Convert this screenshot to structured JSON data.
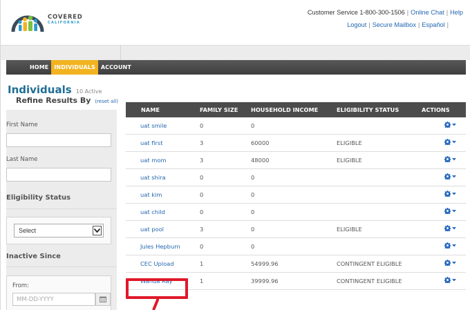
{
  "header": {
    "logo_line1": "COVERED",
    "logo_line2": "CALIFORNIA",
    "customer_service": "Customer Service 1-800-300-1506",
    "online_chat": "Online Chat",
    "help": "Help",
    "logout": "Logout",
    "secure_mailbox": "Secure Mailbox",
    "espanol": "Español"
  },
  "nav": {
    "items": [
      {
        "label": "HOME"
      },
      {
        "label": "INDIVIDUALS"
      },
      {
        "label": "ACCOUNT"
      }
    ]
  },
  "sidebar": {
    "title": "Individuals",
    "active_count": "10 Active",
    "refine_title": "Refine Results By",
    "reset_all": "(reset all)",
    "first_name_label": "First Name",
    "last_name_label": "Last Name",
    "eligibility_title": "Eligibility Status",
    "eligibility_select": "Select",
    "inactive_title": "Inactive Since",
    "from_label": "From:",
    "date_placeholder": "MM-DD-YYYY"
  },
  "table": {
    "headers": {
      "name": "NAME",
      "family_size": "FAMILY SIZE",
      "household_income": "HOUSEHOLD INCOME",
      "eligibility_status": "ELIGIBILITY STATUS",
      "actions": "ACTIONS"
    },
    "rows": [
      {
        "name": "uat smile",
        "family_size": "0",
        "income": "0",
        "eligibility": ""
      },
      {
        "name": "uat first",
        "family_size": "3",
        "income": "60000",
        "eligibility": "ELIGIBLE"
      },
      {
        "name": "uat mom",
        "family_size": "3",
        "income": "48000",
        "eligibility": "ELIGIBLE"
      },
      {
        "name": "uat shira",
        "family_size": "0",
        "income": "0",
        "eligibility": ""
      },
      {
        "name": "uat kim",
        "family_size": "0",
        "income": "0",
        "eligibility": ""
      },
      {
        "name": "uat child",
        "family_size": "0",
        "income": "0",
        "eligibility": ""
      },
      {
        "name": "uat pool",
        "family_size": "3",
        "income": "0",
        "eligibility": "ELIGIBLE"
      },
      {
        "name": "Jules Hepburn",
        "family_size": "0",
        "income": "0",
        "eligibility": ""
      },
      {
        "name": "CEC Upload",
        "family_size": "1",
        "income": "54999.96",
        "eligibility": "CONTINGENT ELIGIBLE"
      },
      {
        "name": "Wanda Ray",
        "family_size": "1",
        "income": "39999.96",
        "eligibility": "CONTINGENT ELIGIBLE"
      }
    ]
  },
  "colors": {
    "nav_bg": "#4a4a4a",
    "nav_active": "#f2b320",
    "link": "#2266b0",
    "title": "#1f6e96",
    "highlight": "#e0182a"
  }
}
